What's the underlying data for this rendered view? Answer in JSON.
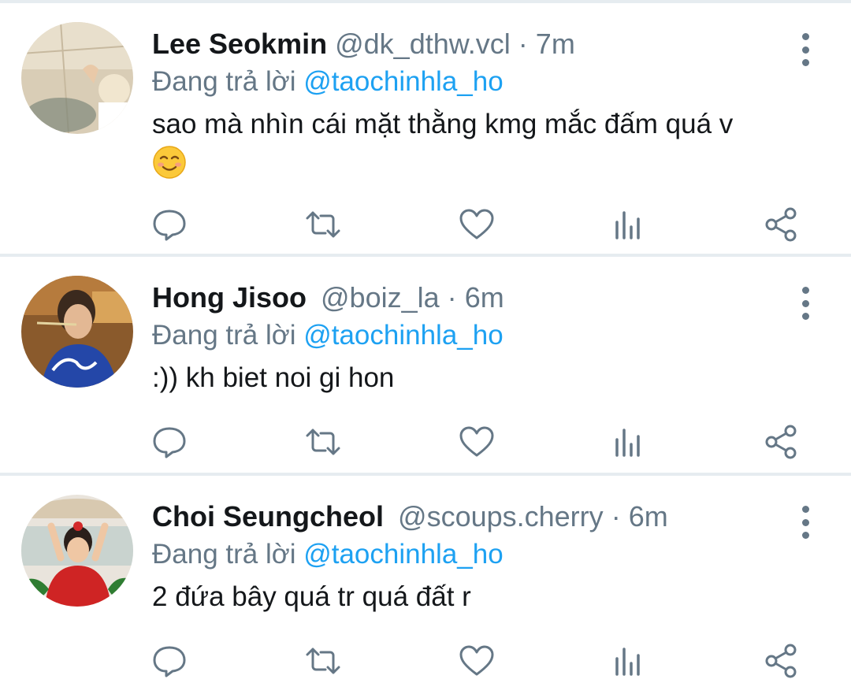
{
  "tweets": [
    {
      "name": "Lee Seokmin",
      "handle": "@dk_dthw.vcl",
      "separator": "·",
      "time": "7m",
      "reply_prefix": "Đang trả lời",
      "reply_to": "@taochinhla_ho",
      "text": "sao mà nhìn cái mặt thằng kmg mắc đấm quá v",
      "emoji": "smiling-face-icon"
    },
    {
      "name": "Hong Jisoo",
      "handle": "@boiz_la",
      "separator": "·",
      "time": "6m",
      "reply_prefix": "Đang trả lời",
      "reply_to": "@taochinhla_ho",
      "text": ":)) kh biet noi gi hon"
    },
    {
      "name": "Choi Seungcheol",
      "handle": "@scoups.cherry",
      "separator": "·",
      "time": "6m",
      "reply_prefix": "Đang trả lời",
      "reply_to": "@taochinhla_ho",
      "text": "2 đứa bây quá tr quá đất r"
    }
  ],
  "actions": [
    "reply-icon",
    "retweet-icon",
    "like-icon",
    "analytics-icon",
    "share-icon"
  ],
  "colors": {
    "icon": "#657786",
    "link": "#1da1f2",
    "separator": "#e6ecf0",
    "text": "#14171a"
  }
}
